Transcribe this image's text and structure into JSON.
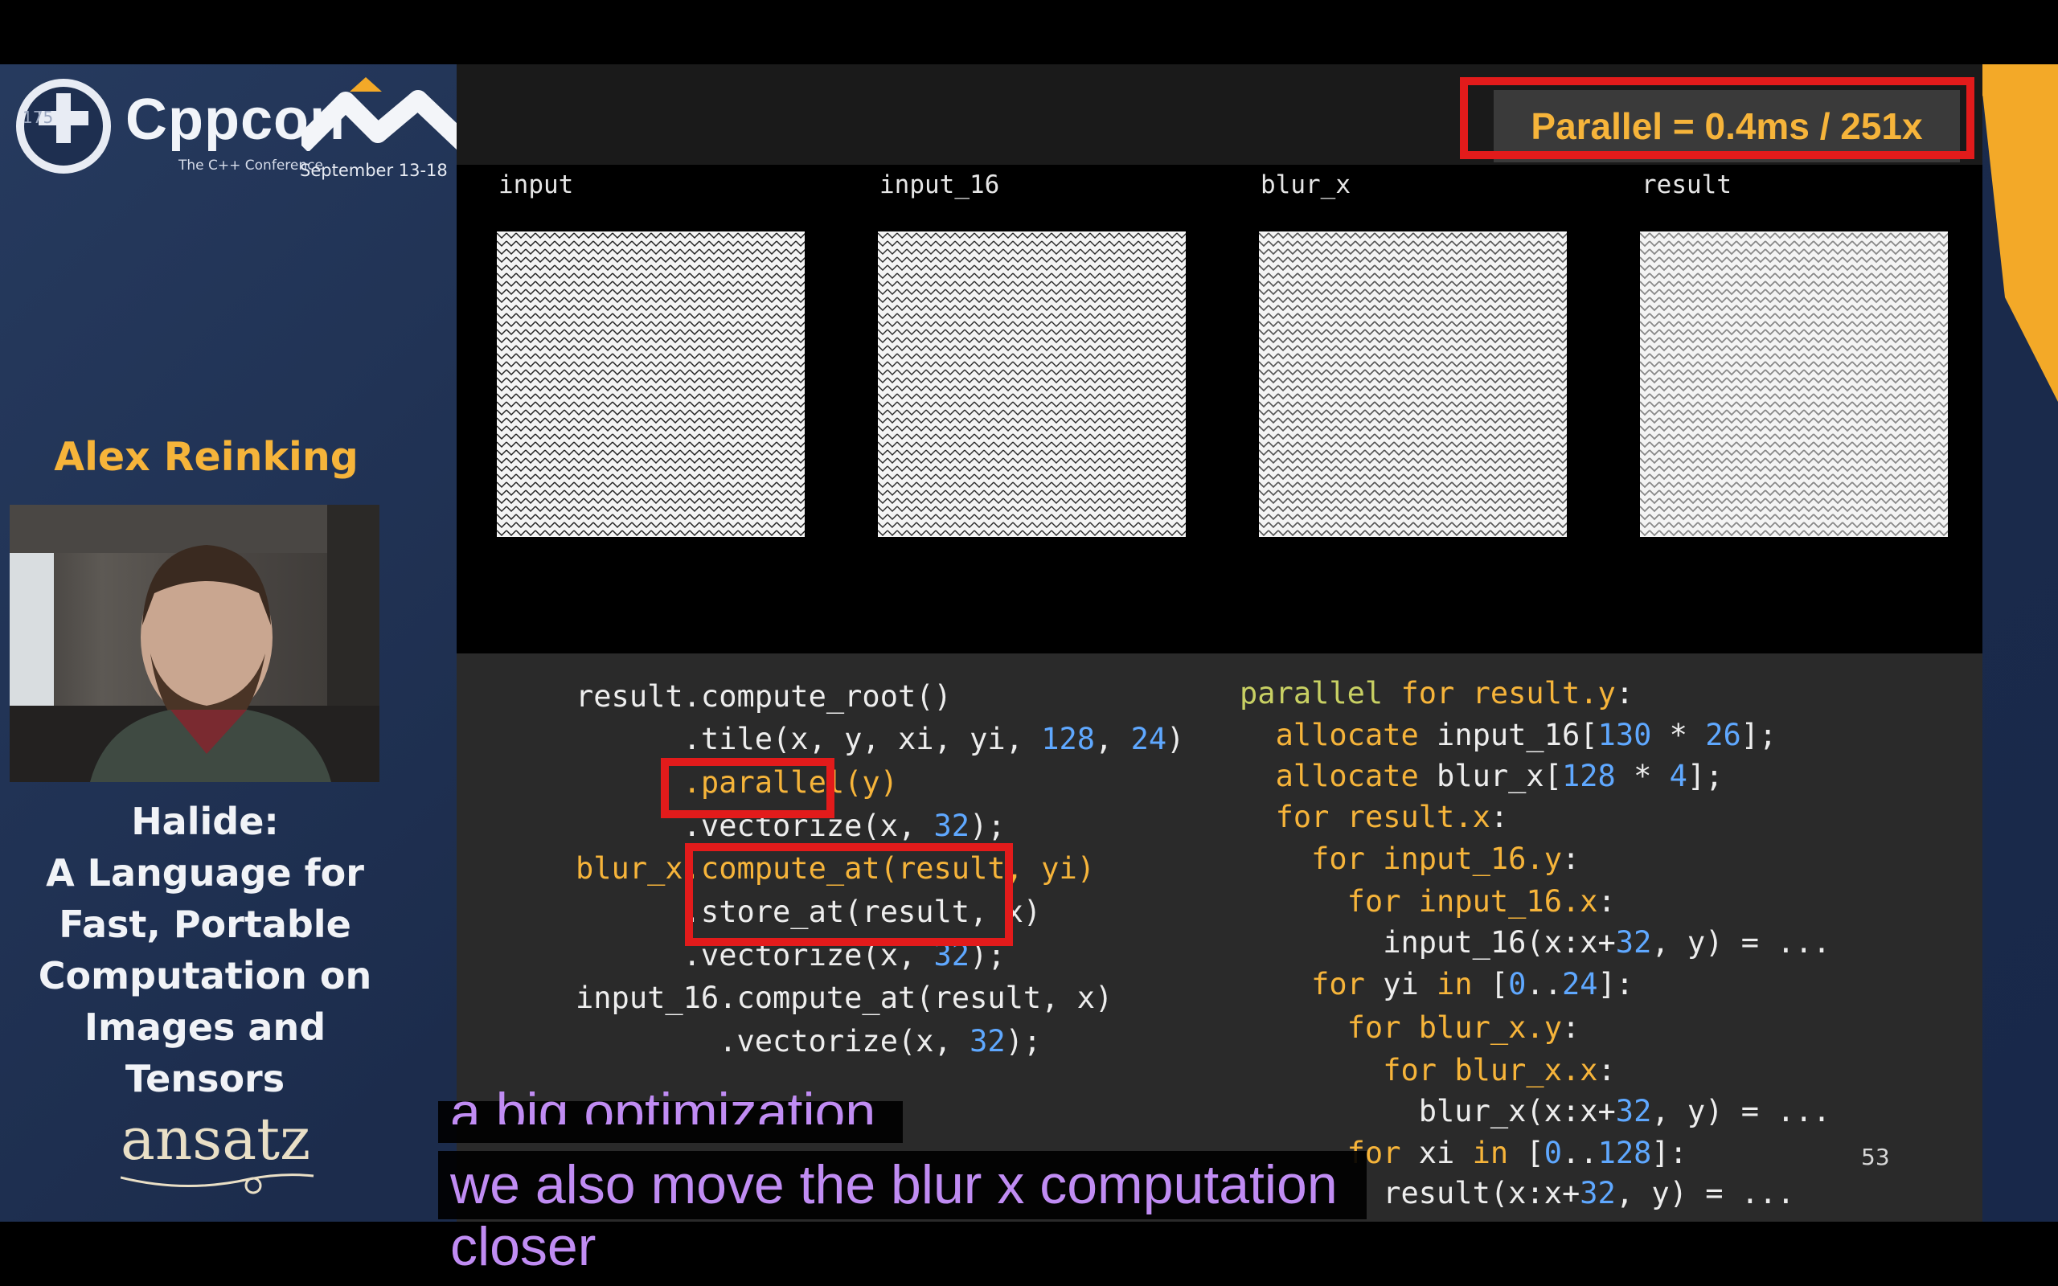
{
  "conference": {
    "badge": "175",
    "name": "Cppcon",
    "tagline": "The C++ Conference",
    "dates": "September 13-18"
  },
  "speaker": {
    "name": "Alex Reinking"
  },
  "talk": {
    "title_lines": [
      "Halide:",
      "A Language for",
      "Fast, Portable",
      "Computation on",
      "Images and",
      "Tensors"
    ]
  },
  "sponsor": {
    "name": "ansatz"
  },
  "slide": {
    "timing": "Parallel = 0.4ms / 251x",
    "images": [
      {
        "label": "input"
      },
      {
        "label": "input_16"
      },
      {
        "label": "blur_x"
      },
      {
        "label": "result"
      }
    ],
    "page_number": "53"
  },
  "captions": {
    "line_prev": "a big optimization",
    "line_current": "we also move the blur x computation",
    "line_next": "closer"
  },
  "colors": {
    "highlight": "#e21b1b",
    "accent": "#f6b43a",
    "number": "#5fa8ff",
    "caption": "#c08cf3"
  }
}
